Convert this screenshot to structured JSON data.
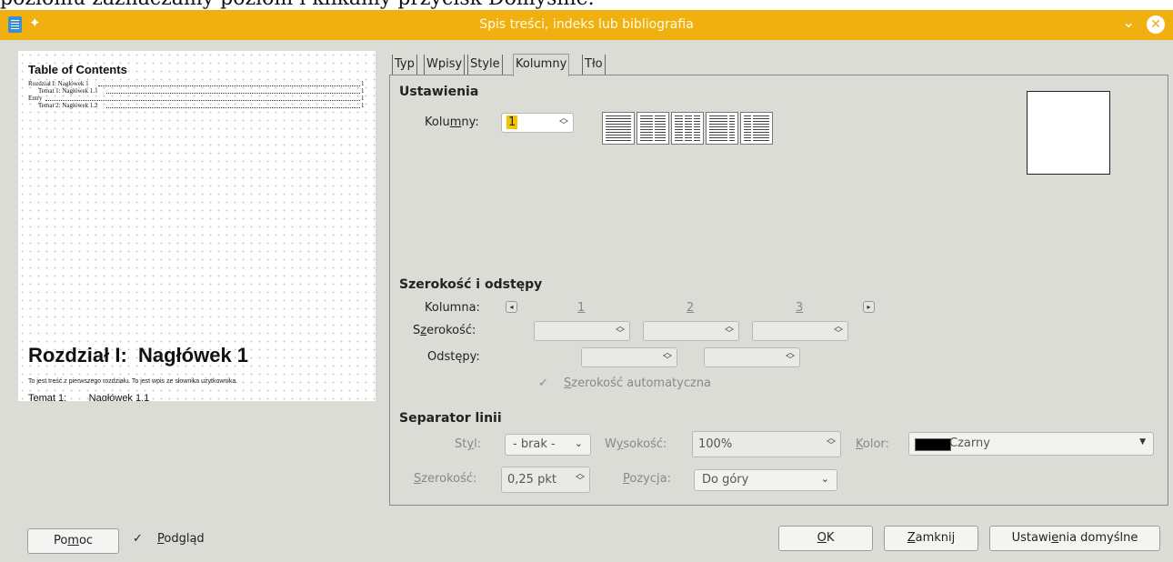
{
  "background_text": "poziomu zaznaczamy poziom i klikamy przycisk Domyślne.",
  "window": {
    "title": "Spis treści, indeks lub bibliografia"
  },
  "preview": {
    "toc_title": "Table of Contents",
    "entries": [
      {
        "text": "Rozdział I: Nagłówek 1",
        "page": "1"
      },
      {
        "text": "Temat 1: Nagłówek 1.1",
        "page": "1"
      },
      {
        "text": "Entry",
        "page": "1"
      },
      {
        "text": "Temat 2: Nagłówek 1.2",
        "page": "1"
      }
    ],
    "chapter_heading": "Rozdział I:  Nagłówek 1",
    "body_text": "To jest treść z pierwszego rozdziału. To jest wpis ze słownika użytkownika.",
    "subheading": "Temat 1:        Nagłówek 1.1"
  },
  "tabs": [
    "Typ",
    "Wpisy",
    "Style",
    "Kolumny",
    "Tło"
  ],
  "active_tab": "Kolumny",
  "settings": {
    "heading": "Ustawienia",
    "columns_label_pre": "Kolu",
    "columns_label_ul": "m",
    "columns_label_post": "ny:",
    "columns_value": "1"
  },
  "width_spacing": {
    "heading": "Szerokość i odstępy",
    "column_label": "Kolumna:",
    "column_numbers": [
      "1",
      "2",
      "3"
    ],
    "width_label_pre": "S",
    "width_label_ul": "z",
    "width_label_post": "erokość:",
    "spacing_label": "Odstępy:",
    "autowidth_ul": "S",
    "autowidth_post": "zerokość automatyczna"
  },
  "separator": {
    "heading": "Separator linii",
    "style_label_pre": "St",
    "style_label_ul": "y",
    "style_label_post": "l:",
    "style_value": "- brak -",
    "height_label_pre": "W",
    "height_label_ul": "y",
    "height_label_post": "sokość:",
    "height_value": "100%",
    "color_label_ul": "K",
    "color_label_post": "olor:",
    "color_value": "Czarny",
    "color_swatch": "#000000",
    "width_label_ul": "S",
    "width_label_post": "zerokość:",
    "width_value": "0,25 pkt",
    "position_label_ul": "P",
    "position_label_post": "ozycja:",
    "position_value": "Do góry"
  },
  "footer": {
    "help_pre": "Po",
    "help_ul": "m",
    "help_post": "oc",
    "preview_ul": "P",
    "preview_post": "odgląd",
    "ok_ul": "O",
    "ok_post": "K",
    "close_ul": "Z",
    "close_post": "amknij",
    "defaults_pre": "Ustawi",
    "defaults_ul": "e",
    "defaults_post": "nia domyślne"
  },
  "colors": {
    "titlebar": "#f0b00f",
    "dialog_bg": "#dcdcd6"
  }
}
